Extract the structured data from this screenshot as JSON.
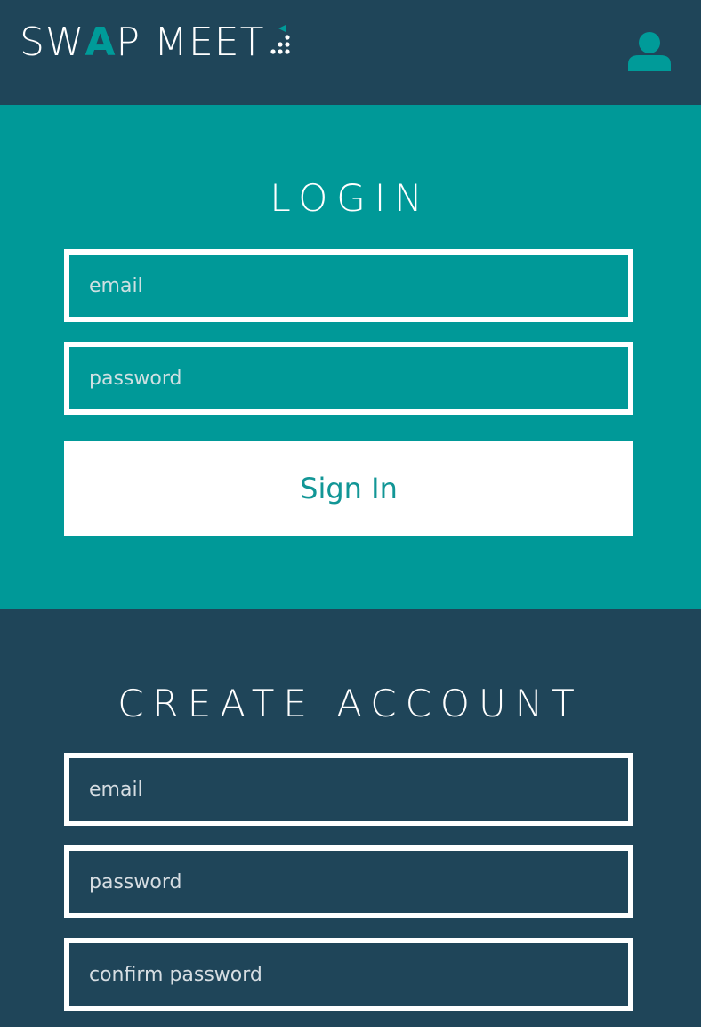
{
  "header": {
    "logo_part1": "SW",
    "logo_accent": "A",
    "logo_part2": "P MEET",
    "logo_icon": "arrow-dots-mark",
    "user_icon": "user-icon",
    "accent_color": "#009b99",
    "bg_color": "#1f4559"
  },
  "login": {
    "title": "LOGIN",
    "email_placeholder": "email",
    "password_placeholder": "password",
    "submit_label": "Sign In",
    "bg_color": "#009998"
  },
  "create_account": {
    "title": "CREATE ACCOUNT",
    "email_placeholder": "email",
    "password_placeholder": "password",
    "confirm_placeholder": "confirm password",
    "bg_color": "#1f4559"
  }
}
